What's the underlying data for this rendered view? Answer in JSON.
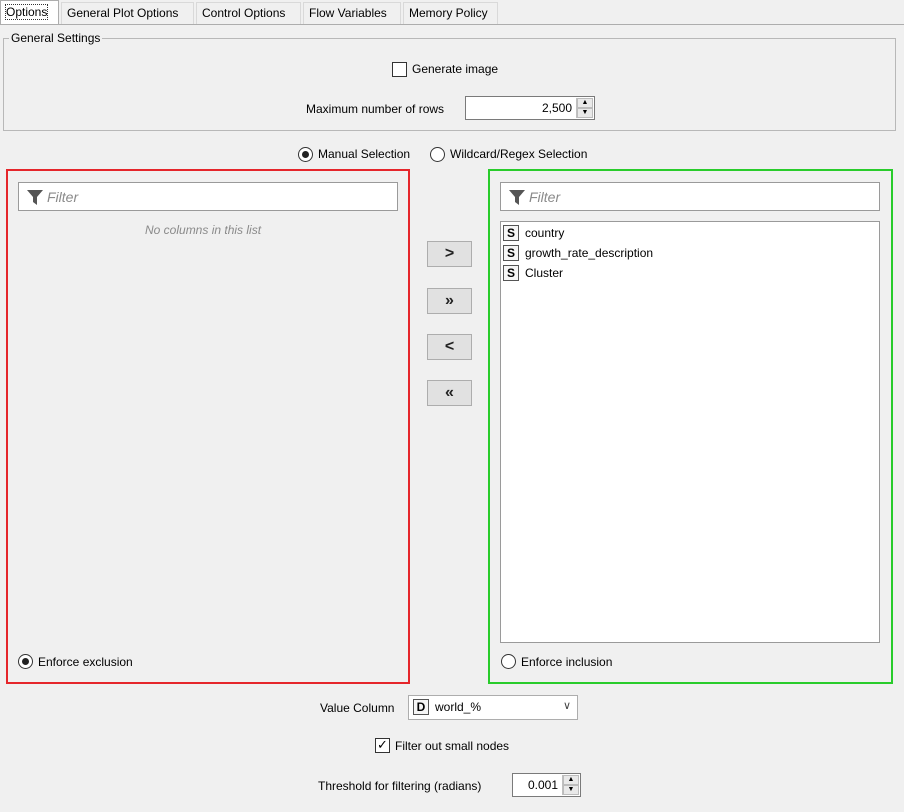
{
  "tabs": [
    {
      "label": "Options",
      "active": true
    },
    {
      "label": "General Plot Options",
      "active": false
    },
    {
      "label": "Control Options",
      "active": false
    },
    {
      "label": "Flow Variables",
      "active": false
    },
    {
      "label": "Memory Policy",
      "active": false
    }
  ],
  "general_settings": {
    "title": "General Settings",
    "generate_image_label": "Generate image",
    "generate_image_checked": false,
    "max_rows_label": "Maximum number of rows",
    "max_rows_value": "2,500"
  },
  "selection_mode": {
    "manual_label": "Manual Selection",
    "wildcard_label": "Wildcard/Regex Selection",
    "selected": "manual"
  },
  "exclude_panel": {
    "filter_placeholder": "Filter",
    "empty_message": "No columns in this list",
    "enforce_label": "Enforce exclusion",
    "enforce_selected": true,
    "border_color": "#e5262b"
  },
  "include_panel": {
    "filter_placeholder": "Filter",
    "columns": [
      {
        "type": "S",
        "name": "country"
      },
      {
        "type": "S",
        "name": "growth_rate_description"
      },
      {
        "type": "S",
        "name": "Cluster"
      }
    ],
    "enforce_label": "Enforce inclusion",
    "enforce_selected": false,
    "border_color": "#29cc2b"
  },
  "move_buttons": {
    "add": ">",
    "add_all": "»",
    "remove": "<",
    "remove_all": "«"
  },
  "value_column": {
    "label": "Value Column",
    "type": "D",
    "selected": "world_%"
  },
  "filter_small_nodes": {
    "label": "Filter out small nodes",
    "checked": true
  },
  "threshold": {
    "label": "Threshold for filtering (radians)",
    "value": "0.001"
  }
}
